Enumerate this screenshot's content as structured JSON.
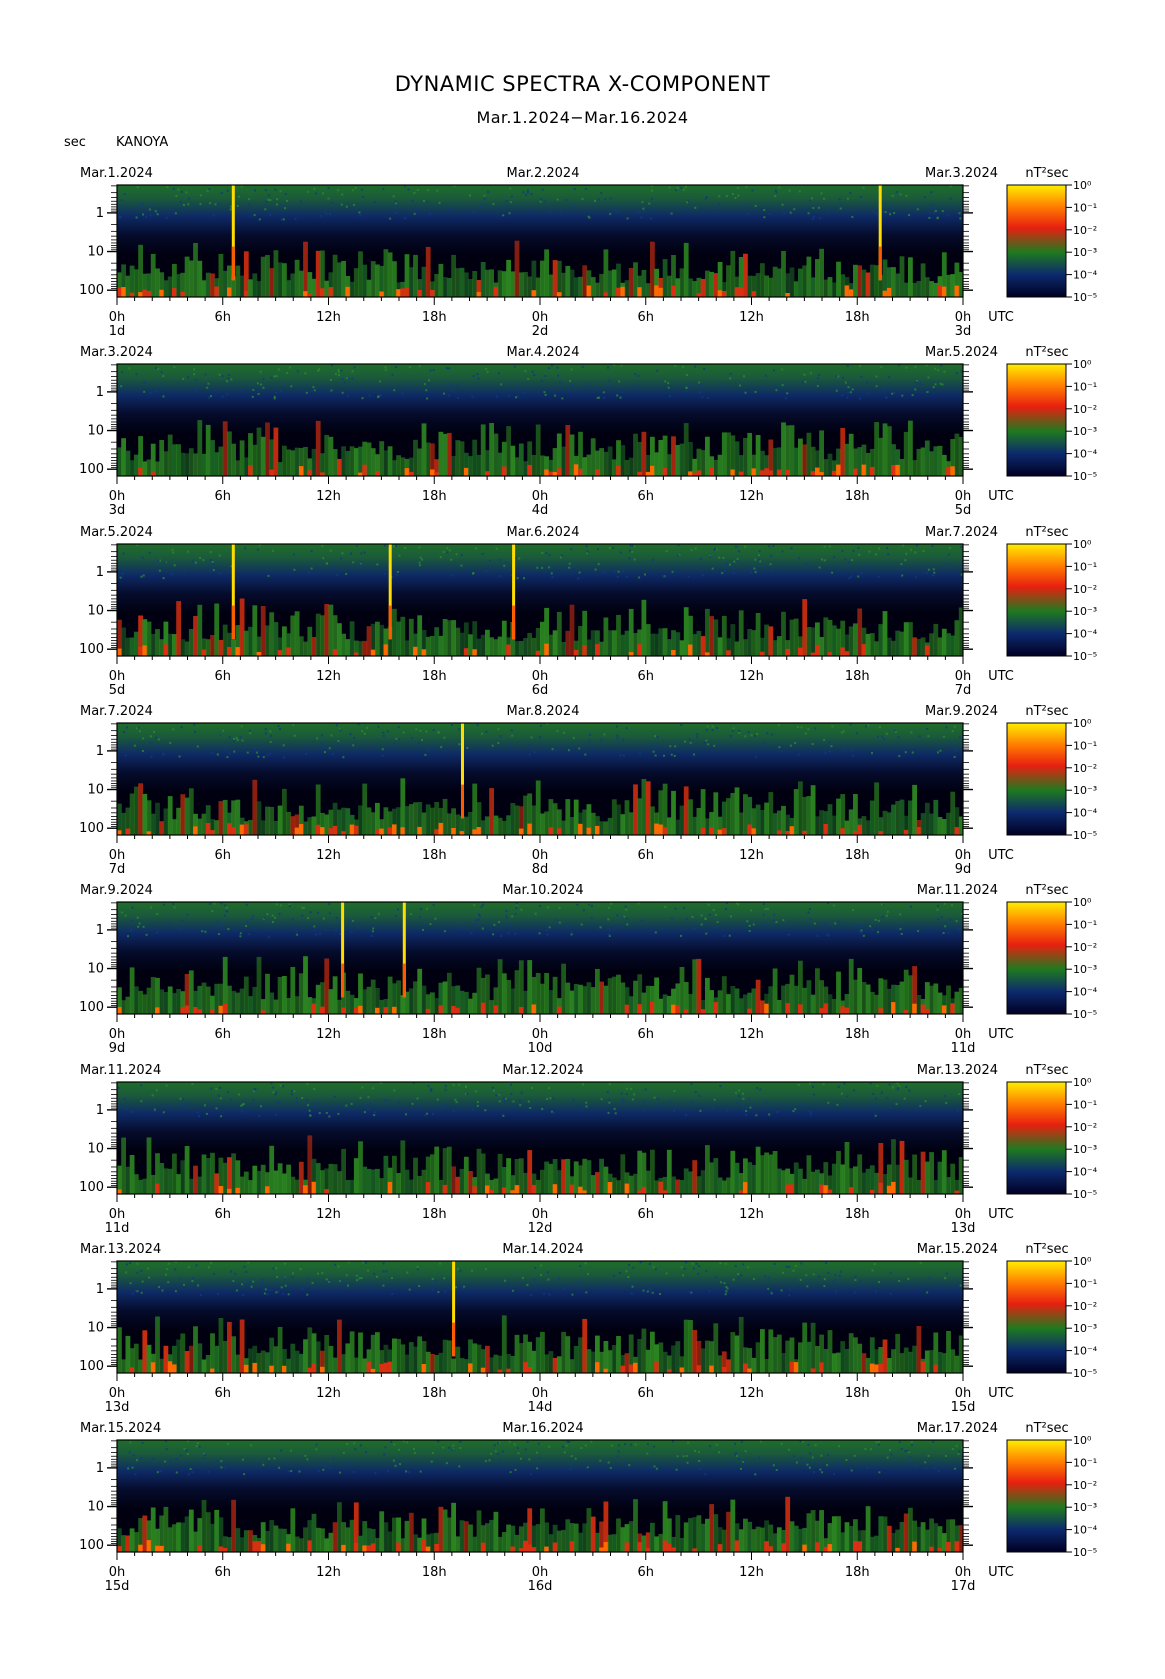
{
  "header": {
    "title": "DYNAMIC SPECTRA X-COMPONENT",
    "subtitle": "Mar.1.2024−Mar.16.2024",
    "y_unit": "sec",
    "station": "KANOYA"
  },
  "colors": {
    "scale": [
      "#000033",
      "#0a1a66",
      "#1f6b1f",
      "#e03010",
      "#ff6a00",
      "#ffee00"
    ]
  },
  "chart_data": {
    "type": "heatmap",
    "x_unit": "UTC",
    "y_axis": {
      "label": "sec",
      "scale": "log",
      "ticks": [
        "1",
        "10",
        "100"
      ],
      "tick_values": [
        1,
        10,
        100
      ]
    },
    "x_ticks": [
      "0h",
      "6h",
      "12h",
      "18h",
      "0h",
      "6h",
      "12h",
      "18h",
      "0h"
    ],
    "colorbar": {
      "unit": "nT²sec",
      "ticks": [
        "10⁰",
        "10⁻¹",
        "10⁻²",
        "10⁻³",
        "10⁻⁴",
        "10⁻⁵"
      ],
      "range": [
        1e-05,
        1
      ],
      "scale": "log"
    },
    "panels": [
      {
        "date_left": "Mar.1.2024",
        "date_mid": "Mar.2.2024",
        "date_right": "Mar.3.2024",
        "day_labels": [
          "1d",
          "2d",
          "3d"
        ],
        "spikes": [
          6.6,
          43.3
        ]
      },
      {
        "date_left": "Mar.3.2024",
        "date_mid": "Mar.4.2024",
        "date_right": "Mar.5.2024",
        "day_labels": [
          "3d",
          "4d",
          "5d"
        ],
        "spikes": []
      },
      {
        "date_left": "Mar.5.2024",
        "date_mid": "Mar.6.2024",
        "date_right": "Mar.7.2024",
        "day_labels": [
          "5d",
          "6d",
          "7d"
        ],
        "spikes": [
          6.6,
          15.5,
          22.5
        ]
      },
      {
        "date_left": "Mar.7.2024",
        "date_mid": "Mar.8.2024",
        "date_right": "Mar.9.2024",
        "day_labels": [
          "7d",
          "8d",
          "9d"
        ],
        "spikes": [
          19.6
        ]
      },
      {
        "date_left": "Mar.9.2024",
        "date_mid": "Mar.10.2024",
        "date_right": "Mar.11.2024",
        "day_labels": [
          "9d",
          "10d",
          "11d"
        ],
        "spikes": [
          12.8,
          16.3
        ]
      },
      {
        "date_left": "Mar.11.2024",
        "date_mid": "Mar.12.2024",
        "date_right": "Mar.13.2024",
        "day_labels": [
          "11d",
          "12d",
          "13d"
        ],
        "spikes": []
      },
      {
        "date_left": "Mar.13.2024",
        "date_mid": "Mar.14.2024",
        "date_right": "Mar.15.2024",
        "day_labels": [
          "13d",
          "14d",
          "15d"
        ],
        "spikes": [
          19.1
        ]
      },
      {
        "date_left": "Mar.15.2024",
        "date_mid": "Mar.16.2024",
        "date_right": "Mar.17.2024",
        "day_labels": [
          "15d",
          "16d",
          "17d"
        ],
        "spikes": []
      }
    ]
  }
}
